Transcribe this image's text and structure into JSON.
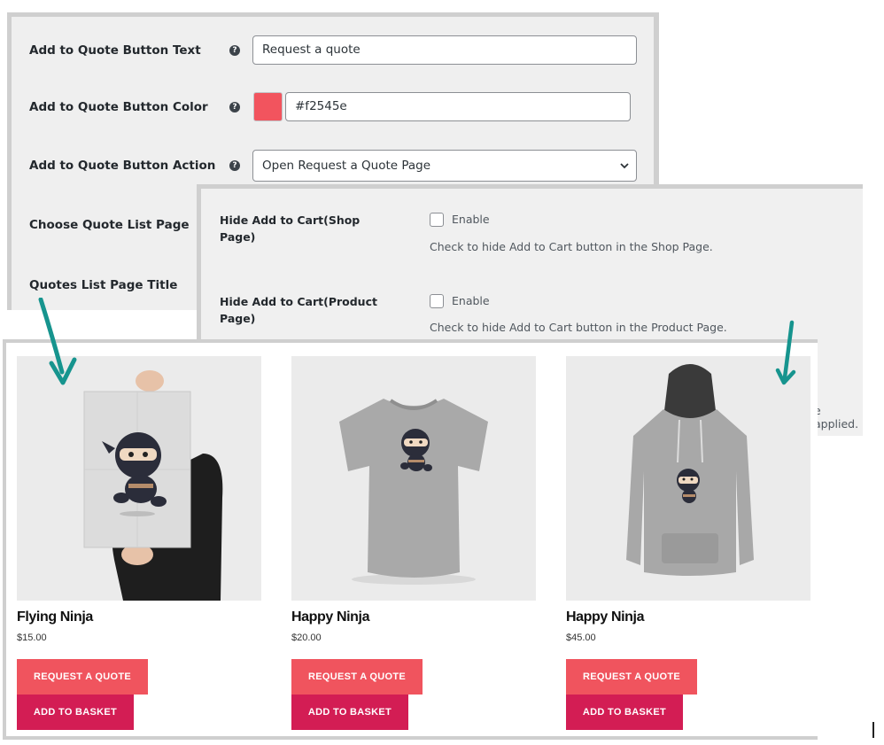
{
  "settings": {
    "button_text_label": "Add to Quote Button Text",
    "button_text_value": "Request a quote",
    "button_color_label": "Add to Quote Button Color",
    "button_color_value": "#f2545e",
    "button_action_label": "Add to Quote Button Action",
    "button_action_value": "Open Request a Quote Page",
    "quote_list_page_label": "Choose Quote List Page",
    "quotes_list_title_label": "Quotes List Page Title",
    "help_glyph": "?"
  },
  "hide_cart": {
    "shop_label": "Hide Add to Cart(Shop Page)",
    "shop_enable": "Enable",
    "shop_desc": "Check to hide Add to Cart button in the Shop Page.",
    "product_label": "Hide Add to Cart(Product Page)",
    "product_enable": "Enable",
    "product_desc": "Check to hide Add to Cart button in the Product Page.",
    "clipped_text": "e applied."
  },
  "products": [
    {
      "title": "Flying Ninja",
      "price": "$15.00",
      "quote_label": "Request a quote",
      "basket_label": "Add to basket",
      "icon": "poster-image"
    },
    {
      "title": "Happy Ninja",
      "price": "$20.00",
      "quote_label": "Request a quote",
      "basket_label": "Add to basket",
      "icon": "tshirt-image"
    },
    {
      "title": "Happy Ninja",
      "price": "$45.00",
      "quote_label": "Request a quote",
      "basket_label": "Add to basket",
      "icon": "hoodie-image"
    }
  ],
  "colors": {
    "quote_button": "#f0545e",
    "basket_button": "#d31d54",
    "annotation_arrow": "#16948e",
    "swatch": "#f2545e"
  }
}
